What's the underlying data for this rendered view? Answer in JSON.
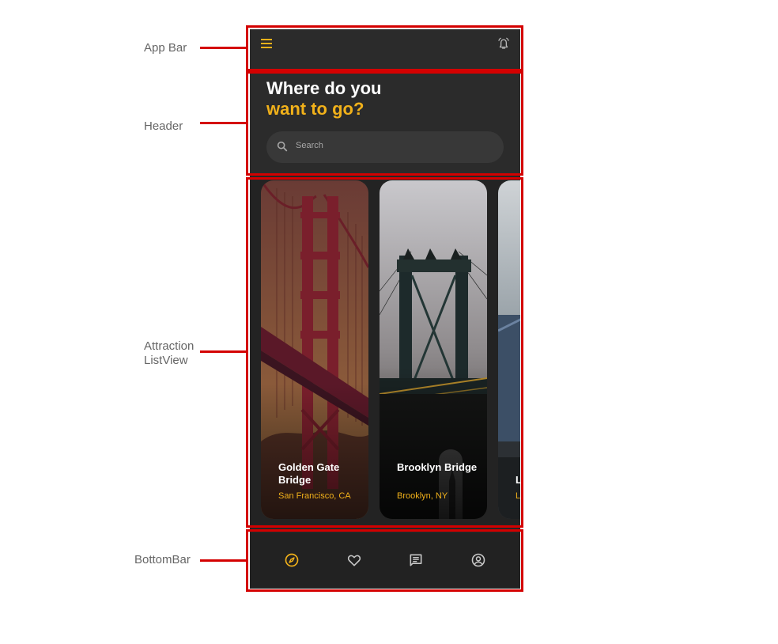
{
  "annotations": {
    "app_bar": "App Bar",
    "header": "Header",
    "attraction_listview_line1": "Attraction",
    "attraction_listview_line2": "ListView",
    "bottom_bar": "BottomBar"
  },
  "app_bar": {
    "menu_icon": "menu-icon",
    "alarm_icon": "alarm-icon"
  },
  "header": {
    "title_line1": "Where do you",
    "title_line2": "want to go?",
    "search_placeholder": "Search"
  },
  "attractions": [
    {
      "name": "Golden Gate Bridge",
      "location": "San Francisco, CA"
    },
    {
      "name": "Brooklyn Bridge",
      "location": "Brooklyn, NY"
    },
    {
      "name": "L",
      "location": "L"
    }
  ],
  "bottom_bar": {
    "items": [
      "explore-icon",
      "favorite-icon",
      "messages-icon",
      "profile-icon"
    ],
    "active_index": 0
  },
  "colors": {
    "accent": "#f1b11a",
    "annotation": "#d40000",
    "background": "#262626"
  }
}
